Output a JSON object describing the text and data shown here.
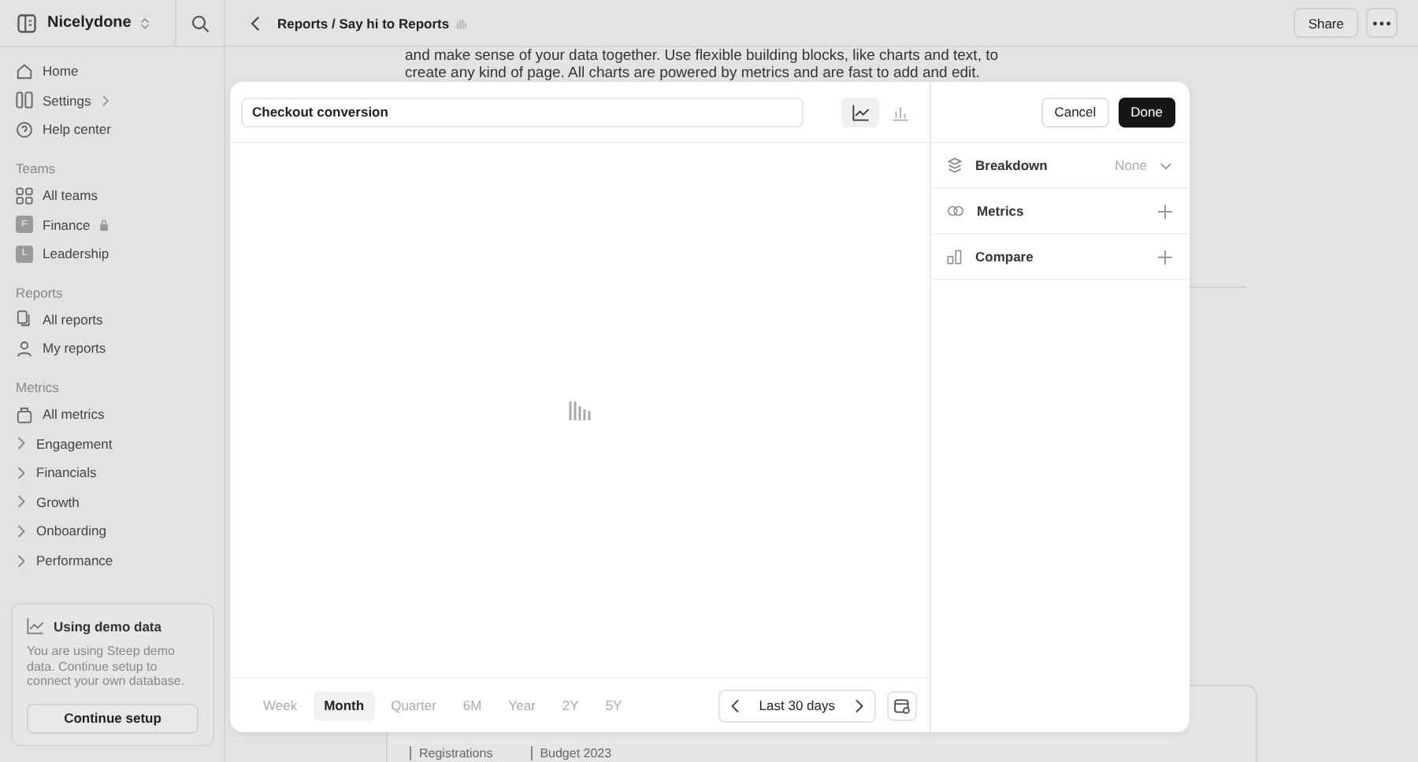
{
  "workspace": {
    "name": "Nicelydone"
  },
  "breadcrumb": "Reports / Say hi to Reports",
  "header_buttons": [
    "Share"
  ],
  "sidebar": {
    "items": [
      {
        "label": "Home",
        "submenu": false
      },
      {
        "label": "Settings",
        "submenu": true
      },
      {
        "label": "Help center",
        "submenu": false
      }
    ],
    "sections": [
      {
        "title": "Teams",
        "items": [
          {
            "label": "All teams",
            "kind": "icon",
            "locked": false
          },
          {
            "label": "Finance",
            "kind": "avatar",
            "badge": "F",
            "locked": true
          },
          {
            "label": "Leadership",
            "kind": "avatar",
            "badge": "L",
            "locked": false
          }
        ]
      },
      {
        "title": "Reports",
        "items": [
          {
            "label": "All reports",
            "kind": "icon",
            "locked": false
          },
          {
            "label": "My reports",
            "kind": "icon",
            "locked": false
          }
        ]
      },
      {
        "title": "Metrics",
        "items": [
          {
            "label": "All metrics",
            "kind": "icon",
            "locked": false
          },
          {
            "label": "Engagement",
            "kind": "group",
            "locked": false
          },
          {
            "label": "Financials",
            "kind": "group",
            "locked": false
          },
          {
            "label": "Growth",
            "kind": "group",
            "locked": false
          },
          {
            "label": "Onboarding",
            "kind": "group",
            "locked": false
          },
          {
            "label": "Performance",
            "kind": "group",
            "locked": false
          }
        ]
      }
    ]
  },
  "demo_card": {
    "title": "Using demo data",
    "text": "You are using Steep demo data. Continue setup to connect your own database.",
    "button": "Continue setup"
  },
  "page": {
    "paragraph_lines": [
      "and make sense of your data together. Use flexible building blocks, like charts and text, to",
      "create any kind of page. All charts are powered by metrics and are fast to add and edit."
    ],
    "legend": [
      "Registrations",
      "Budget 2023"
    ]
  },
  "modal": {
    "title_value": "Checkout conversion",
    "chart_types": [
      {
        "kind": "line",
        "selected": true
      },
      {
        "kind": "bar",
        "selected": false
      }
    ],
    "cancel": "Cancel",
    "done": "Done",
    "settings": [
      {
        "label": "Breakdown",
        "kind": "select",
        "value": "None"
      },
      {
        "label": "Metrics",
        "kind": "add"
      },
      {
        "label": "Compare",
        "kind": "add"
      }
    ],
    "ranges": [
      {
        "label": "Week",
        "selected": false
      },
      {
        "label": "Month",
        "selected": true
      },
      {
        "label": "Quarter",
        "selected": false
      },
      {
        "label": "6M",
        "selected": false
      },
      {
        "label": "Year",
        "selected": false
      },
      {
        "label": "2Y",
        "selected": false
      },
      {
        "label": "5Y",
        "selected": false
      }
    ],
    "period": "Last 30 days"
  }
}
